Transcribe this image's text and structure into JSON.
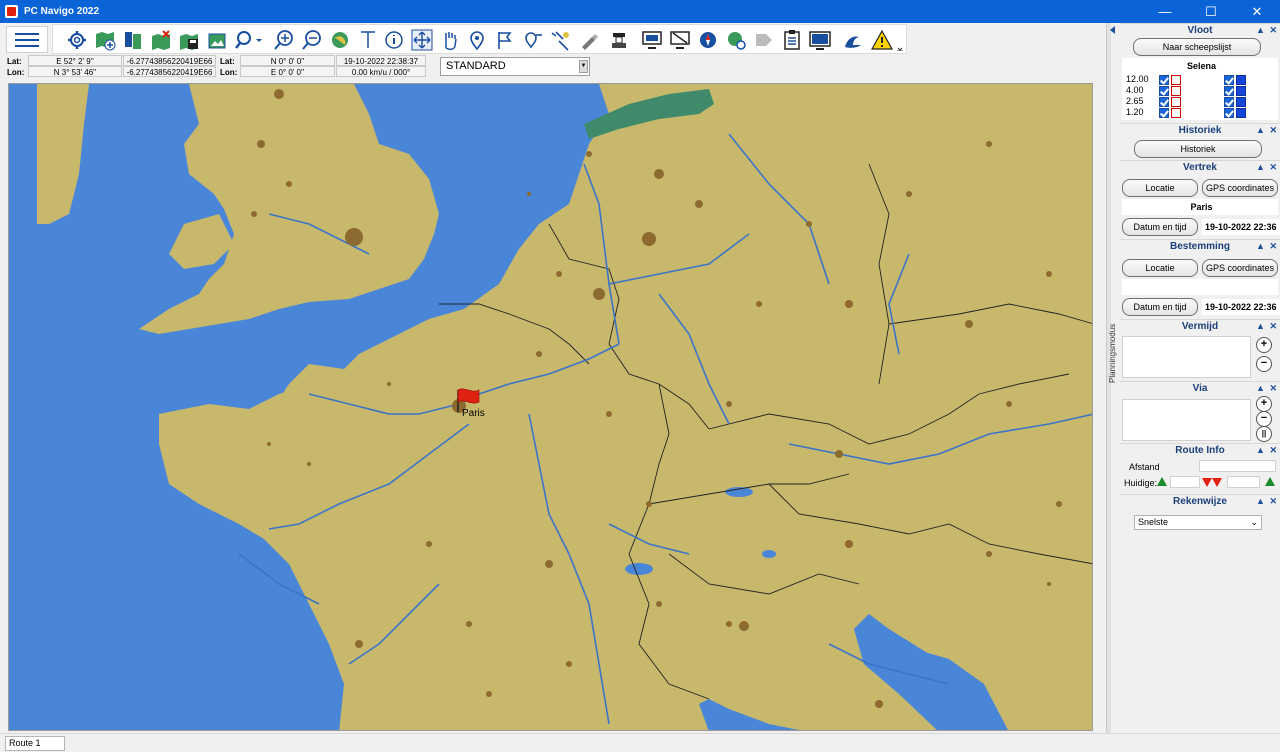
{
  "window": {
    "title": "PC Navigo 2022",
    "minimize": "—",
    "maximize": "☐",
    "close": "✕"
  },
  "toolbar": {
    "icons": [
      "settings-icon",
      "map-add-icon",
      "map-layers-icon",
      "map-remove-icon",
      "save-icon",
      "image-export-icon",
      "search-icon",
      "zoom-in-icon",
      "zoom-out-icon",
      "globe-icon",
      "text-icon",
      "info-icon",
      "pan-arrows-icon",
      "hand-icon",
      "pin-icon",
      "flag-icon",
      "route-pin-icon",
      "satellite-icon",
      "pen-icon",
      "dredger-icon",
      "monitor-icon",
      "monitor-crossed-icon",
      "compass-icon",
      "globe-gear-icon",
      "tag-icon",
      "clipboard-icon",
      "screen-icon",
      "wave-icon",
      "warning-icon"
    ]
  },
  "coords": {
    "lat_label": "Lat:",
    "lon_label": "Lon:",
    "lat_value": "E 52° 2' 9''",
    "lon_value": "N 3° 53' 46''",
    "lat_raw": "-6.27743856220419E66",
    "lon_raw": "-6.27743856220419E66",
    "lat2_label": "Lat:",
    "lon2_label": "Lon:",
    "lat2_value": "N 0° 0' 0''",
    "lon2_value": "E 0° 0' 0''",
    "datetime": "19-10-2022 22:38:37",
    "speed": "0.00  km/u / 000°",
    "style_select": "STANDARD"
  },
  "map": {
    "city_label": "Paris",
    "water_color": "#4a86d8",
    "land_color": "#c8b86c",
    "river_color": "#3a74c8",
    "urban_color": "#8c6a30"
  },
  "sidepanel": {
    "tab_label": "Planningsmodus",
    "vloot": {
      "header": "Vloot",
      "button": "Naar scheepslijst",
      "ship": "Selena",
      "dims": [
        "12.00",
        "4.00",
        "2.65",
        "1.20"
      ]
    },
    "historiek": {
      "header": "Historiek",
      "button": "Historiek"
    },
    "vertrek": {
      "header": "Vertrek",
      "locatie": "Locatie",
      "gps": "GPS coordinates",
      "place": "Paris",
      "datum_btn": "Datum en tijd",
      "datum": "19-10-2022 22:36"
    },
    "bestemming": {
      "header": "Bestemming",
      "locatie": "Locatie",
      "gps": "GPS coordinates",
      "place": "",
      "datum_btn": "Datum en tijd",
      "datum": "19-10-2022 22:36"
    },
    "vermijd": {
      "header": "Vermijd",
      "plus": "+",
      "minus": "−"
    },
    "via": {
      "header": "Via",
      "plus": "+",
      "minus": "−",
      "pause": "||"
    },
    "route_info": {
      "header": "Route Info",
      "afstand": "Afstand",
      "huidige": "Huidige:"
    },
    "rekenwijze": {
      "header": "Rekenwijze",
      "selected": "Snelste"
    },
    "header_ctrls": "▲ ✕"
  },
  "status": {
    "route": "Route 1"
  }
}
